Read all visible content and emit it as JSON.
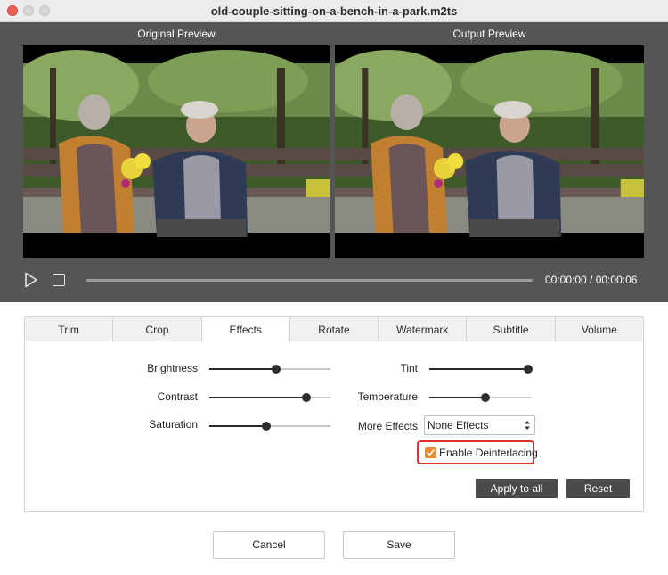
{
  "window": {
    "title": "old-couple-sitting-on-a-bench-in-a-park.m2ts"
  },
  "preview": {
    "original_label": "Original Preview",
    "output_label": "Output  Preview",
    "time": "00:00:00 / 00:00:06",
    "play_icon": "play-icon",
    "stop_icon": "stop-icon"
  },
  "tabs": [
    {
      "label": "Trim"
    },
    {
      "label": "Crop"
    },
    {
      "label": "Effects",
      "active": true
    },
    {
      "label": "Rotate"
    },
    {
      "label": "Watermark"
    },
    {
      "label": "Subtitle"
    },
    {
      "label": "Volume"
    }
  ],
  "effects": {
    "sliders": [
      {
        "label": "Brightness",
        "value": 0.55
      },
      {
        "label": "Contrast",
        "value": 0.8
      },
      {
        "label": "Saturation",
        "value": 0.47
      },
      {
        "label": "Tint",
        "value": 1.0
      },
      {
        "label": "Temperature",
        "value": 0.55
      }
    ],
    "more_effects_label": "More Effects",
    "more_effects_value": "None Effects",
    "deinterlace_label": "Enable Deinterlacing",
    "deinterlace_checked": true,
    "apply_all_label": "Apply to all",
    "reset_label": "Reset"
  },
  "footer": {
    "cancel_label": "Cancel",
    "save_label": "Save"
  },
  "colors": {
    "checkbox": "#f08a2e",
    "highlight": "#e0332e",
    "dark_button": "#4a4a4a",
    "preview_bg": "#555555"
  }
}
